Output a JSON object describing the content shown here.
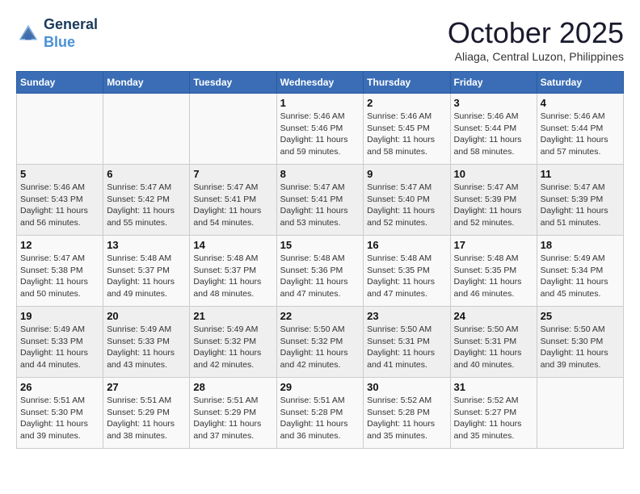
{
  "header": {
    "logo_line1": "General",
    "logo_line2": "Blue",
    "month": "October 2025",
    "location": "Aliaga, Central Luzon, Philippines"
  },
  "weekdays": [
    "Sunday",
    "Monday",
    "Tuesday",
    "Wednesday",
    "Thursday",
    "Friday",
    "Saturday"
  ],
  "weeks": [
    [
      {
        "day": "",
        "info": ""
      },
      {
        "day": "",
        "info": ""
      },
      {
        "day": "",
        "info": ""
      },
      {
        "day": "1",
        "info": "Sunrise: 5:46 AM\nSunset: 5:46 PM\nDaylight: 11 hours\nand 59 minutes."
      },
      {
        "day": "2",
        "info": "Sunrise: 5:46 AM\nSunset: 5:45 PM\nDaylight: 11 hours\nand 58 minutes."
      },
      {
        "day": "3",
        "info": "Sunrise: 5:46 AM\nSunset: 5:44 PM\nDaylight: 11 hours\nand 58 minutes."
      },
      {
        "day": "4",
        "info": "Sunrise: 5:46 AM\nSunset: 5:44 PM\nDaylight: 11 hours\nand 57 minutes."
      }
    ],
    [
      {
        "day": "5",
        "info": "Sunrise: 5:46 AM\nSunset: 5:43 PM\nDaylight: 11 hours\nand 56 minutes."
      },
      {
        "day": "6",
        "info": "Sunrise: 5:47 AM\nSunset: 5:42 PM\nDaylight: 11 hours\nand 55 minutes."
      },
      {
        "day": "7",
        "info": "Sunrise: 5:47 AM\nSunset: 5:41 PM\nDaylight: 11 hours\nand 54 minutes."
      },
      {
        "day": "8",
        "info": "Sunrise: 5:47 AM\nSunset: 5:41 PM\nDaylight: 11 hours\nand 53 minutes."
      },
      {
        "day": "9",
        "info": "Sunrise: 5:47 AM\nSunset: 5:40 PM\nDaylight: 11 hours\nand 52 minutes."
      },
      {
        "day": "10",
        "info": "Sunrise: 5:47 AM\nSunset: 5:39 PM\nDaylight: 11 hours\nand 52 minutes."
      },
      {
        "day": "11",
        "info": "Sunrise: 5:47 AM\nSunset: 5:39 PM\nDaylight: 11 hours\nand 51 minutes."
      }
    ],
    [
      {
        "day": "12",
        "info": "Sunrise: 5:47 AM\nSunset: 5:38 PM\nDaylight: 11 hours\nand 50 minutes."
      },
      {
        "day": "13",
        "info": "Sunrise: 5:48 AM\nSunset: 5:37 PM\nDaylight: 11 hours\nand 49 minutes."
      },
      {
        "day": "14",
        "info": "Sunrise: 5:48 AM\nSunset: 5:37 PM\nDaylight: 11 hours\nand 48 minutes."
      },
      {
        "day": "15",
        "info": "Sunrise: 5:48 AM\nSunset: 5:36 PM\nDaylight: 11 hours\nand 47 minutes."
      },
      {
        "day": "16",
        "info": "Sunrise: 5:48 AM\nSunset: 5:35 PM\nDaylight: 11 hours\nand 47 minutes."
      },
      {
        "day": "17",
        "info": "Sunrise: 5:48 AM\nSunset: 5:35 PM\nDaylight: 11 hours\nand 46 minutes."
      },
      {
        "day": "18",
        "info": "Sunrise: 5:49 AM\nSunset: 5:34 PM\nDaylight: 11 hours\nand 45 minutes."
      }
    ],
    [
      {
        "day": "19",
        "info": "Sunrise: 5:49 AM\nSunset: 5:33 PM\nDaylight: 11 hours\nand 44 minutes."
      },
      {
        "day": "20",
        "info": "Sunrise: 5:49 AM\nSunset: 5:33 PM\nDaylight: 11 hours\nand 43 minutes."
      },
      {
        "day": "21",
        "info": "Sunrise: 5:49 AM\nSunset: 5:32 PM\nDaylight: 11 hours\nand 42 minutes."
      },
      {
        "day": "22",
        "info": "Sunrise: 5:50 AM\nSunset: 5:32 PM\nDaylight: 11 hours\nand 42 minutes."
      },
      {
        "day": "23",
        "info": "Sunrise: 5:50 AM\nSunset: 5:31 PM\nDaylight: 11 hours\nand 41 minutes."
      },
      {
        "day": "24",
        "info": "Sunrise: 5:50 AM\nSunset: 5:31 PM\nDaylight: 11 hours\nand 40 minutes."
      },
      {
        "day": "25",
        "info": "Sunrise: 5:50 AM\nSunset: 5:30 PM\nDaylight: 11 hours\nand 39 minutes."
      }
    ],
    [
      {
        "day": "26",
        "info": "Sunrise: 5:51 AM\nSunset: 5:30 PM\nDaylight: 11 hours\nand 39 minutes."
      },
      {
        "day": "27",
        "info": "Sunrise: 5:51 AM\nSunset: 5:29 PM\nDaylight: 11 hours\nand 38 minutes."
      },
      {
        "day": "28",
        "info": "Sunrise: 5:51 AM\nSunset: 5:29 PM\nDaylight: 11 hours\nand 37 minutes."
      },
      {
        "day": "29",
        "info": "Sunrise: 5:51 AM\nSunset: 5:28 PM\nDaylight: 11 hours\nand 36 minutes."
      },
      {
        "day": "30",
        "info": "Sunrise: 5:52 AM\nSunset: 5:28 PM\nDaylight: 11 hours\nand 35 minutes."
      },
      {
        "day": "31",
        "info": "Sunrise: 5:52 AM\nSunset: 5:27 PM\nDaylight: 11 hours\nand 35 minutes."
      },
      {
        "day": "",
        "info": ""
      }
    ]
  ]
}
